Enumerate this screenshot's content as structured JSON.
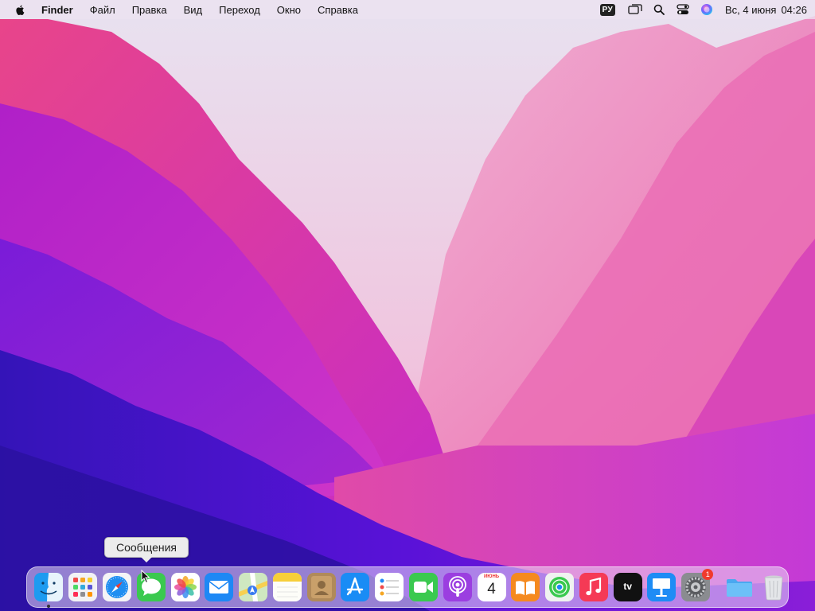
{
  "menubar": {
    "app_name": "Finder",
    "menus": [
      "Файл",
      "Правка",
      "Вид",
      "Переход",
      "Окно",
      "Справка"
    ],
    "input_source": "РУ",
    "date": "Вс, 4 июня",
    "time": "04:26"
  },
  "tooltip": {
    "text": "Сообщения"
  },
  "dock": {
    "calendar_month": "ИЮНЬ",
    "calendar_day": "4",
    "tv_label": "tv",
    "settings_badge": "1",
    "items": [
      "finder-icon",
      "launchpad-icon",
      "safari-icon",
      "messages-icon",
      "photos-icon",
      "mail-icon",
      "maps-icon",
      "notes-icon",
      "contacts-icon",
      "app-store-icon",
      "reminders-icon",
      "facetime-icon",
      "podcasts-icon",
      "calendar-icon",
      "books-icon",
      "find-my-icon",
      "music-icon",
      "apple-tv-icon",
      "keynote-icon",
      "system-settings-icon",
      "downloads-folder-icon",
      "trash-icon"
    ]
  }
}
